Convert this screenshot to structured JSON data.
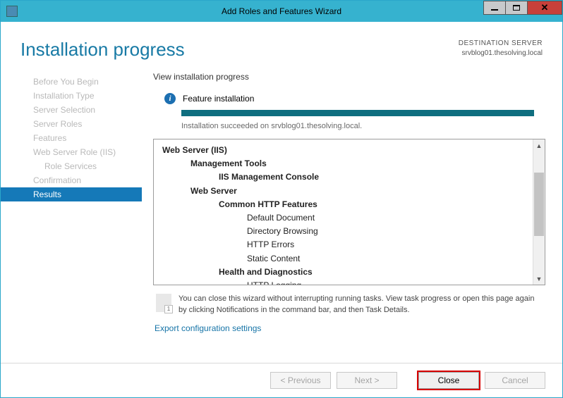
{
  "window": {
    "title": "Add Roles and Features Wizard"
  },
  "header": {
    "page_title": "Installation progress",
    "dest_label": "DESTINATION SERVER",
    "dest_server": "srvblog01.thesolving.local"
  },
  "sidebar": {
    "items": [
      {
        "label": "Before You Begin",
        "active": false,
        "indent": false
      },
      {
        "label": "Installation Type",
        "active": false,
        "indent": false
      },
      {
        "label": "Server Selection",
        "active": false,
        "indent": false
      },
      {
        "label": "Server Roles",
        "active": false,
        "indent": false
      },
      {
        "label": "Features",
        "active": false,
        "indent": false
      },
      {
        "label": "Web Server Role (IIS)",
        "active": false,
        "indent": false
      },
      {
        "label": "Role Services",
        "active": false,
        "indent": true
      },
      {
        "label": "Confirmation",
        "active": false,
        "indent": false
      },
      {
        "label": "Results",
        "active": true,
        "indent": false
      }
    ]
  },
  "main": {
    "subheading": "View installation progress",
    "status_title": "Feature installation",
    "status_text": "Installation succeeded on srvblog01.thesolving.local.",
    "tree": [
      {
        "level": 0,
        "text": "Web Server (IIS)"
      },
      {
        "level": 1,
        "text": "Management Tools"
      },
      {
        "level": 2,
        "text": "IIS Management Console"
      },
      {
        "level": 1,
        "text": "Web Server"
      },
      {
        "level": 2,
        "text": "Common HTTP Features"
      },
      {
        "level": 3,
        "text": "Default Document"
      },
      {
        "level": 3,
        "text": "Directory Browsing"
      },
      {
        "level": 3,
        "text": "HTTP Errors"
      },
      {
        "level": 3,
        "text": "Static Content"
      },
      {
        "level": 2,
        "text": "Health and Diagnostics"
      },
      {
        "level": 3,
        "text": "HTTP Logging"
      }
    ],
    "tip": "You can close this wizard without interrupting running tasks. View task progress or open this page again by clicking Notifications in the command bar, and then Task Details.",
    "export_link": "Export configuration settings"
  },
  "footer": {
    "previous": "< Previous",
    "next": "Next >",
    "close": "Close",
    "cancel": "Cancel"
  }
}
